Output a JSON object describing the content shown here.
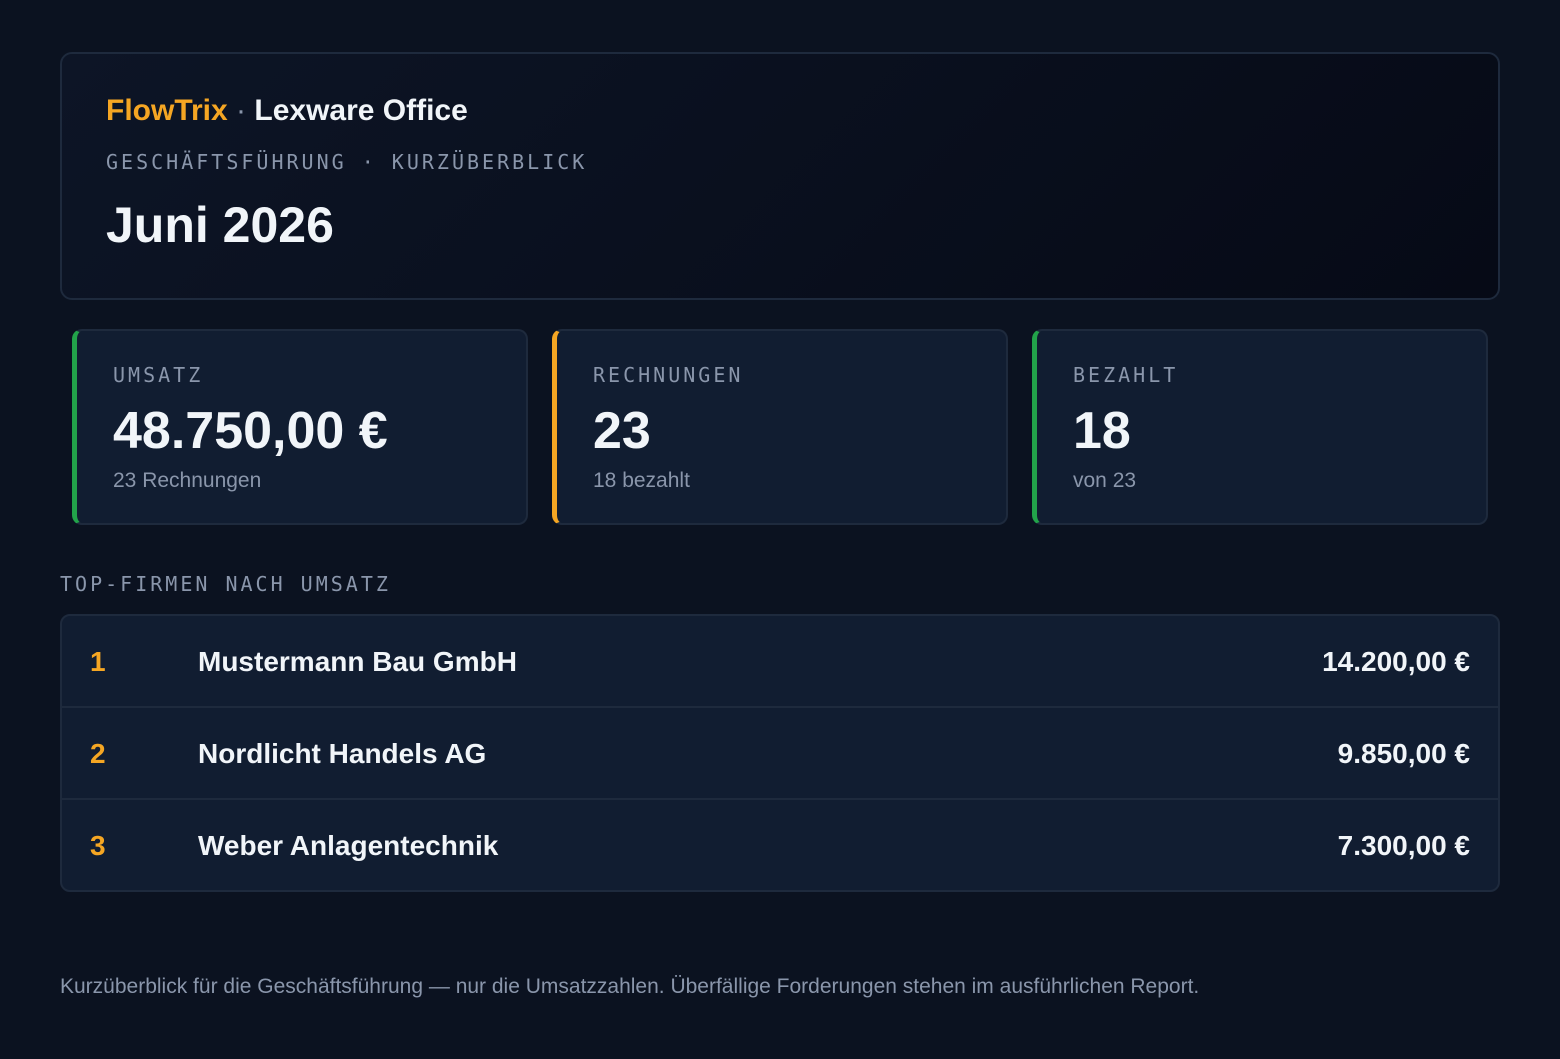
{
  "header": {
    "brand_name": "FlowTrix",
    "brand_separator": "·",
    "product_name": "Lexware Office",
    "subtitle": "GESCHÄFTSFÜHRUNG · KURZÜBERBLICK",
    "title": "Juni 2026"
  },
  "kpis": [
    {
      "label": "UMSATZ",
      "value": "48.750,00 €",
      "sub": "23 Rechnungen",
      "accent": "#22a34a"
    },
    {
      "label": "RECHNUNGEN",
      "value": "23",
      "sub": "18 bezahlt",
      "accent": "#f5a623"
    },
    {
      "label": "BEZAHLT",
      "value": "18",
      "sub": "von 23",
      "accent": "#22a34a"
    }
  ],
  "ranking": {
    "heading": "TOP-FIRMEN NACH UMSATZ",
    "rows": [
      {
        "rank": "1",
        "name": "Mustermann Bau GmbH",
        "amount": "14.200,00 €"
      },
      {
        "rank": "2",
        "name": "Nordlicht Handels AG",
        "amount": "9.850,00 €"
      },
      {
        "rank": "3",
        "name": "Weber Anlagentechnik",
        "amount": "7.300,00 €"
      }
    ]
  },
  "footer": {
    "note": "Kurzüberblick für die Geschäftsführung — nur die Umsatzzahlen. Überfällige Forderungen stehen im ausführlichen Report."
  },
  "colors": {
    "background": "#0b1220",
    "card": "#111d31",
    "accent_orange": "#f5a623",
    "accent_green": "#22a34a",
    "muted_text": "#8a96ab"
  }
}
